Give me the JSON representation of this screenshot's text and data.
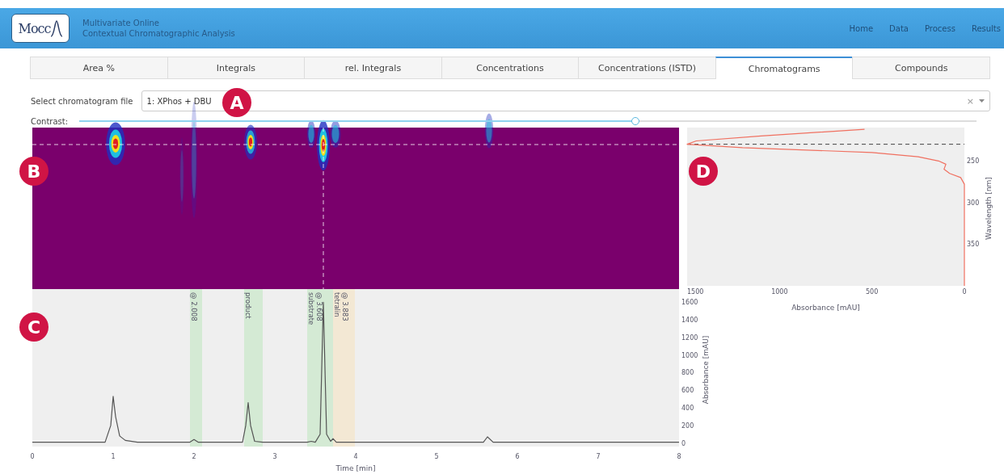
{
  "header": {
    "logo": "Mocc",
    "subtitle_lines": [
      "Multivariate Online",
      "Contextual Chromatographic Analysis"
    ],
    "nav": [
      "Home",
      "Data",
      "Process",
      "Results"
    ]
  },
  "tabs": [
    {
      "label": "Area %",
      "selected": false
    },
    {
      "label": "Integrals",
      "selected": false
    },
    {
      "label": "rel. Integrals",
      "selected": false
    },
    {
      "label": "Concentrations",
      "selected": false
    },
    {
      "label": "Concentrations (ISTD)",
      "selected": false
    },
    {
      "label": "Chromatograms",
      "selected": true
    },
    {
      "label": "Compounds",
      "selected": false
    }
  ],
  "file_select": {
    "label": "Select chromatogram file",
    "value": "1: XPhos + DBU",
    "clear": "×"
  },
  "contrast": {
    "label": "Contrast:",
    "level": 0.62
  },
  "callouts": [
    "A",
    "B",
    "C",
    "D"
  ],
  "chromatogram": {
    "chart_data": {
      "type": "line",
      "xlabel": "Time [min]",
      "ylabel": "Absorbance [mAU]",
      "xlim": [
        0,
        8
      ],
      "ylim": [
        -40,
        1750
      ],
      "xticks": [
        0,
        1,
        2,
        3,
        4,
        5,
        6,
        7,
        8
      ],
      "yticks": [
        0,
        200,
        400,
        600,
        800,
        1000,
        1200,
        1400,
        1600
      ],
      "x": [
        0,
        0.9,
        0.97,
        1.0,
        1.03,
        1.08,
        1.15,
        1.3,
        1.95,
        2.0,
        2.05,
        2.6,
        2.64,
        2.67,
        2.7,
        2.75,
        2.85,
        3.4,
        3.45,
        3.5,
        3.56,
        3.6,
        3.64,
        3.69,
        3.72,
        3.76,
        3.9,
        5.58,
        5.63,
        5.7,
        6,
        8
      ],
      "series": [
        {
          "color": "#555555",
          "values": [
            10,
            10,
            200,
            530,
            300,
            80,
            30,
            10,
            10,
            40,
            10,
            10,
            200,
            460,
            200,
            20,
            10,
            10,
            20,
            10,
            100,
            1600,
            100,
            20,
            50,
            10,
            10,
            10,
            70,
            10,
            10,
            10
          ]
        }
      ],
      "bands": [
        {
          "axis": "x",
          "from": 1.95,
          "to": 2.1,
          "color": "#d4ead4",
          "label": "@ 2.008"
        },
        {
          "axis": "x",
          "from": 2.62,
          "to": 2.85,
          "color": "#d4ead4",
          "label": "product"
        },
        {
          "axis": "x",
          "from": 3.4,
          "to": 3.5,
          "color": "#d4ead4",
          "label": "substrate"
        },
        {
          "axis": "x",
          "from": 3.5,
          "to": 3.72,
          "color": "#d4ead4",
          "label": "@ 3.608"
        },
        {
          "axis": "x",
          "from": 3.72,
          "to": 3.82,
          "color": "#f3e8d4",
          "label": "tetralin"
        },
        {
          "axis": "x",
          "from": 3.82,
          "to": 3.99,
          "color": "#f3e8d4",
          "label": "@ 3.883"
        }
      ]
    }
  },
  "spectrum": {
    "chart_data": {
      "type": "line",
      "orientation": "horizontal",
      "xlabel": "Absorbance [mAU]",
      "ylabel": "Wavelength [nm]",
      "xlim": [
        1500,
        0
      ],
      "ylim": [
        400,
        210
      ],
      "xticks": [
        0,
        500,
        1000,
        1500
      ],
      "yticks": [
        250,
        300,
        350
      ],
      "ref_lines": [
        {
          "axis": "y",
          "value": 230
        }
      ],
      "x": [
        212,
        220,
        226,
        230,
        234,
        240,
        245,
        250,
        254,
        260,
        265,
        270,
        278,
        400
      ],
      "series": [
        {
          "color": "#f07060",
          "values": [
            540,
            1100,
            1450,
            1500,
            1200,
            500,
            250,
            140,
            100,
            110,
            80,
            20,
            0,
            0
          ]
        }
      ]
    }
  }
}
